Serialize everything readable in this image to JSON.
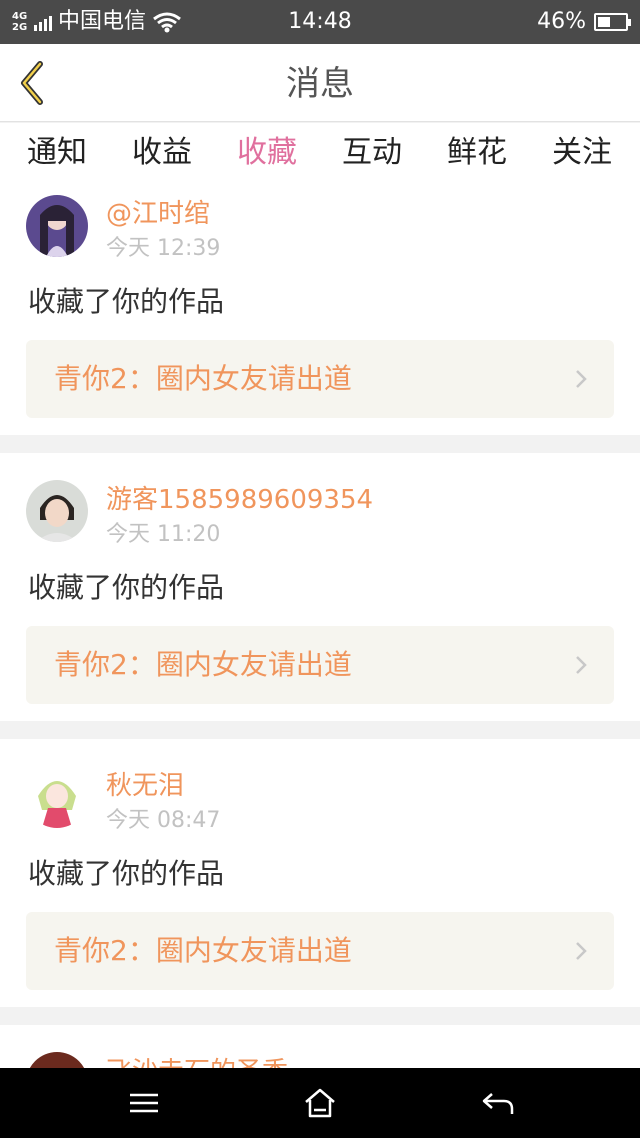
{
  "status_bar": {
    "network": "4G\n2G",
    "carrier": "中国电信",
    "time": "14:48",
    "battery": "46%",
    "battery_level": 0.46
  },
  "header": {
    "title": "消息"
  },
  "tabs": [
    {
      "label": "通知",
      "active": false
    },
    {
      "label": "收益",
      "active": false
    },
    {
      "label": "收藏",
      "active": true
    },
    {
      "label": "互动",
      "active": false
    },
    {
      "label": "鲜花",
      "active": false
    },
    {
      "label": "关注",
      "active": false
    }
  ],
  "messages": [
    {
      "username": "@江时绾",
      "time": "今天 12:39",
      "action": "收藏了你的作品",
      "work": "青你2：圈内女友请出道"
    },
    {
      "username": "游客1585989609354",
      "time": "今天 11:20",
      "action": "收藏了你的作品",
      "work": "青你2：圈内女友请出道"
    },
    {
      "username": "秋无泪",
      "time": "今天 08:47",
      "action": "收藏了你的作品",
      "work": "青你2：圈内女友请出道"
    },
    {
      "username": "飞沙走石的圣香"
    }
  ],
  "colors": {
    "accent": "#e0709e",
    "name": "#f0955c",
    "card_bg": "#f6f5ef",
    "separator": "#f2f2f2"
  }
}
